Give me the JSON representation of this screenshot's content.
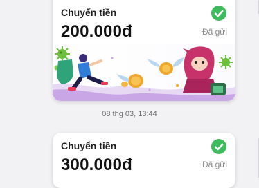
{
  "messages": [
    {
      "title": "Chuyển tiền",
      "amount": "200.000đ",
      "status": "Đã gửi",
      "status_icon": "check-circle-icon",
      "banner": "money-transfer-illustration",
      "timestamp": "08 thg 03, 13:44"
    },
    {
      "title": "Chuyển tiền",
      "amount": "300.000đ",
      "status": "Đã gửi",
      "status_icon": "check-circle-icon"
    }
  ],
  "colors": {
    "background": "#f2f2f4",
    "card": "#ffffff",
    "success": "#3dbb5d",
    "status_text": "#8a8a8a"
  }
}
